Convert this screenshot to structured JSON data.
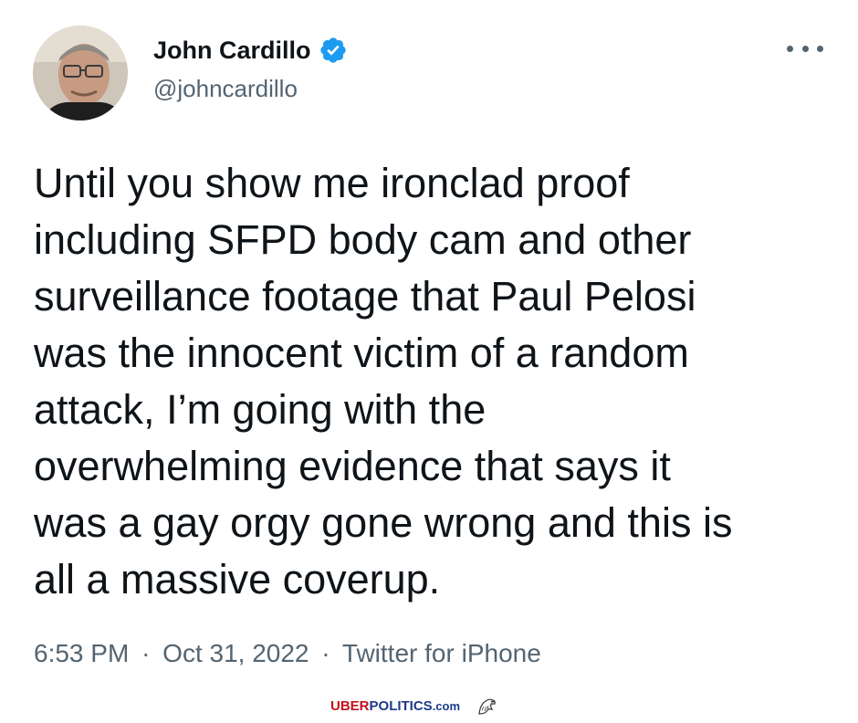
{
  "author": {
    "display_name": "John Cardillo",
    "handle": "@johncardillo",
    "verified": true
  },
  "tweet": {
    "lines": [
      "Until you show me ironclad proof",
      "including SFPD body cam and other",
      "surveillance footage that Paul Pelosi",
      "was the innocent victim of a random",
      "attack, I’m going with the",
      "overwhelming evidence that says it",
      "was a gay orgy gone wrong and this is",
      "all a massive coverup."
    ]
  },
  "meta": {
    "time": "6:53 PM",
    "separator": "·",
    "date": "Oct 31, 2022",
    "source": "Twitter for iPhone"
  },
  "watermark": {
    "part1": "UBER",
    "part2": "POLITICS",
    "part3": ".com"
  },
  "colors": {
    "verified": "#1d9bf0",
    "secondary_text": "#536471",
    "watermark_red": "#c1121f",
    "watermark_blue": "#1d3a8a"
  },
  "icons": {
    "verified": "verified-badge-icon",
    "more": "more-options-icon",
    "watermark": "eagle-icon"
  }
}
